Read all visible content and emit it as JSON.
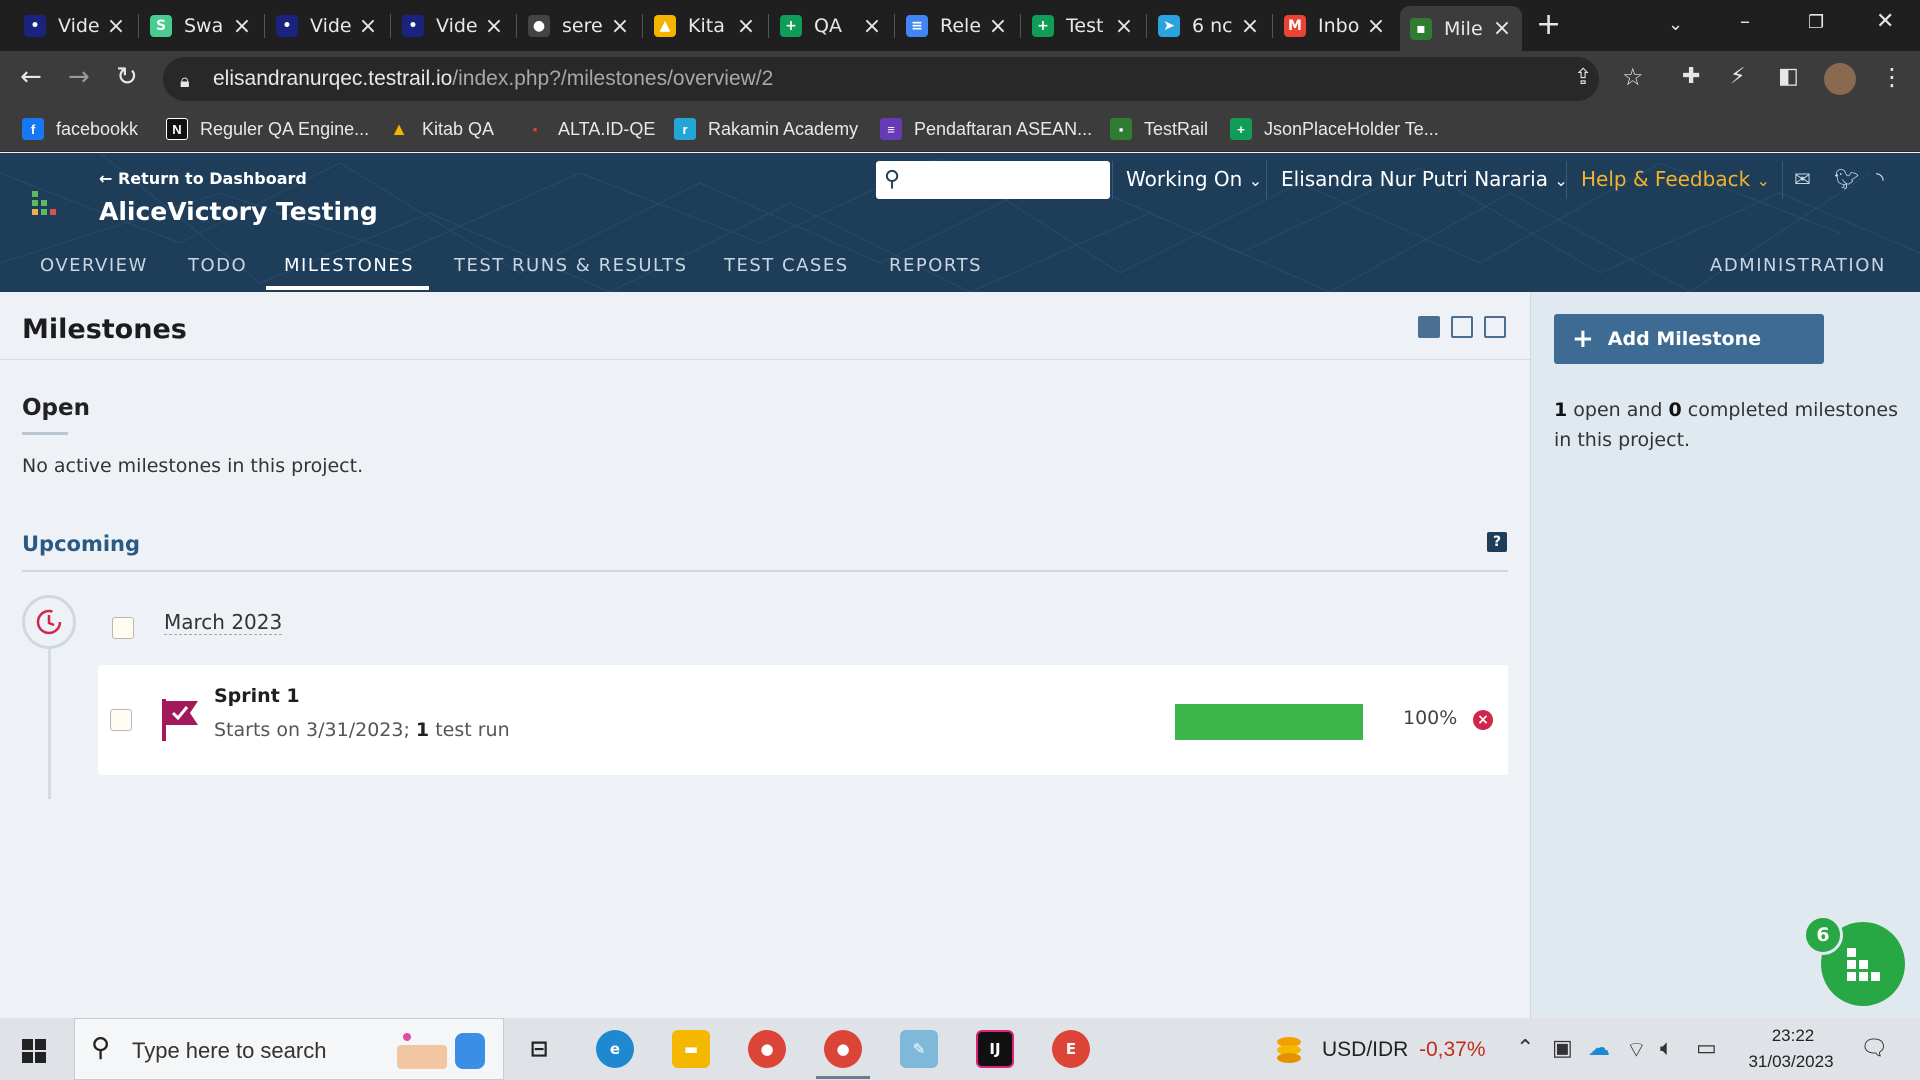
{
  "browser": {
    "tabs": [
      {
        "title": "Vide",
        "icon": "video-icon",
        "color": "#1a237e"
      },
      {
        "title": "Swa",
        "icon": "swagger-icon",
        "color": "#49cc90"
      },
      {
        "title": "Vide",
        "icon": "video-icon",
        "color": "#1a237e"
      },
      {
        "title": "Vide",
        "icon": "video-icon",
        "color": "#1a237e"
      },
      {
        "title": "sere",
        "icon": "github-icon",
        "color": "#444444"
      },
      {
        "title": "Kita",
        "icon": "drive-icon",
        "color": "#f4b400"
      },
      {
        "title": "QA",
        "icon": "sheets-icon",
        "color": "#0f9d58"
      },
      {
        "title": "Rele",
        "icon": "docs-icon",
        "color": "#4285f4"
      },
      {
        "title": "Test",
        "icon": "sheets-icon",
        "color": "#0f9d58"
      },
      {
        "title": "6 nc",
        "icon": "telegram-icon",
        "color": "#2aa3df"
      },
      {
        "title": "Inbo",
        "icon": "gmail-icon",
        "color": "#ea4335"
      },
      {
        "title": "Mile",
        "icon": "testrail-icon",
        "color": "#2f7d32",
        "active": true
      }
    ],
    "url_domain": "elisandranurqec.testrail.io",
    "url_path": "/index.php?/milestones/overview/2",
    "bookmarks": [
      {
        "label": "facebookk",
        "icon": "facebook-icon",
        "color": "#1877f2",
        "glyph": "f"
      },
      {
        "label": "Reguler QA Engine...",
        "icon": "notion-icon",
        "color": "#111111",
        "glyph": "N"
      },
      {
        "label": "Kitab QA",
        "icon": "drive-icon",
        "color": "#f4b400",
        "glyph": "▲"
      },
      {
        "label": "ALTA.ID-QE",
        "icon": "video-icon",
        "color": "#1a237e",
        "glyph": "•"
      },
      {
        "label": "Rakamin Academy",
        "icon": "rakamin-icon",
        "color": "#23a6d5",
        "glyph": "r"
      },
      {
        "label": "Pendaftaran ASEAN...",
        "icon": "forms-icon",
        "color": "#673ab7",
        "glyph": "≡"
      },
      {
        "label": "TestRail",
        "icon": "testrail-icon",
        "color": "#2f7d32",
        "glyph": "▪"
      },
      {
        "label": "JsonPlaceHolder Te...",
        "icon": "sheets-icon",
        "color": "#0f9d58",
        "glyph": "+"
      }
    ]
  },
  "header": {
    "return_link": "← Return to Dashboard",
    "project": "AliceVictory Testing",
    "working_on": "Working On",
    "user": "Elisandra Nur Putri Nararia",
    "help": "Help & Feedback",
    "nav": [
      "OVERVIEW",
      "TODO",
      "MILESTONES",
      "TEST RUNS & RESULTS",
      "TEST CASES",
      "REPORTS"
    ],
    "administration": "ADMINISTRATION",
    "help_color": "#f3b22c"
  },
  "main": {
    "title": "Milestones",
    "open_heading": "Open",
    "open_empty": "No active milestones in this project.",
    "upcoming_heading": "Upcoming",
    "group_label": "March 2023",
    "milestone": {
      "name": "Sprint 1",
      "meta_prefix": "Starts on 3/31/2023; ",
      "run_count": "1",
      "run_suffix": " test run",
      "progress": 1.0,
      "progress_label": "100%"
    }
  },
  "sidebar": {
    "add_button": "Add Milestone",
    "open_count": "1",
    "open_text": " open and ",
    "completed_count": "0",
    "completed_text": " completed milestones in this project."
  },
  "fab_badge": "6",
  "taskbar": {
    "search_placeholder": "Type here to search",
    "currency": "USD/IDR",
    "currency_change": "-0,37%",
    "time": "23:22",
    "date": "31/03/2023"
  }
}
